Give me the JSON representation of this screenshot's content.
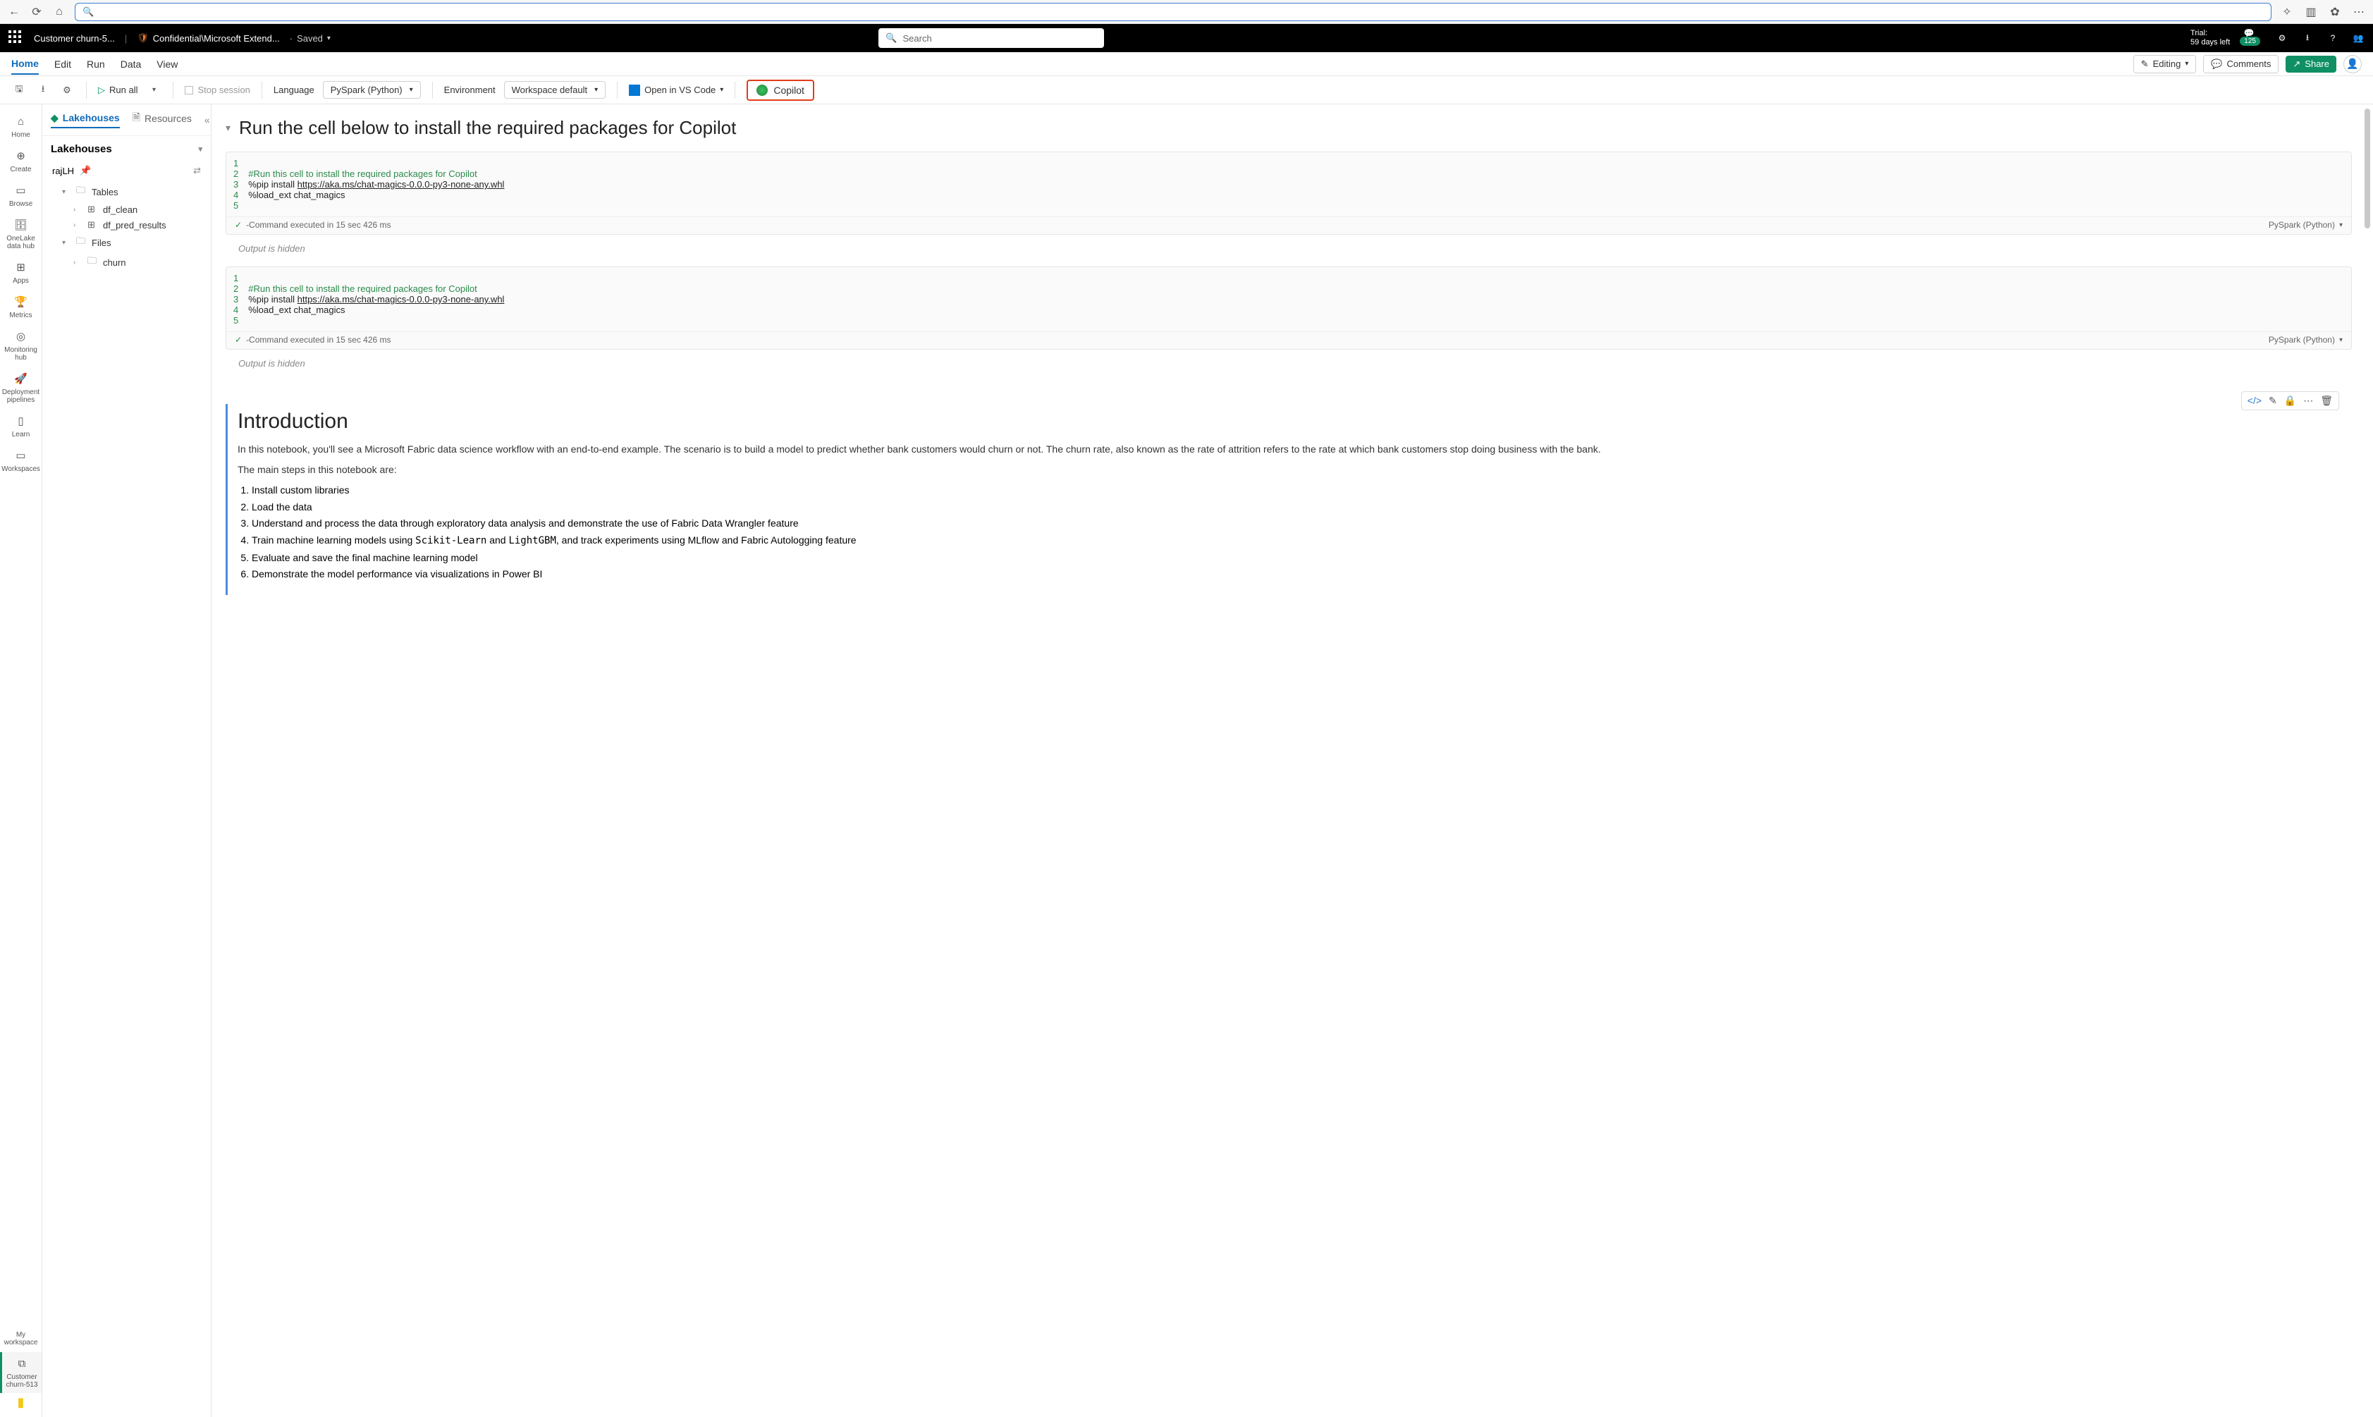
{
  "browser": {
    "search_placeholder": ""
  },
  "header": {
    "doc_title": "Customer churn-5...",
    "confidential": "Confidential\\Microsoft Extend...",
    "saved_label": "Saved",
    "search_placeholder": "Search",
    "trial_label": "Trial:",
    "trial_days": "59 days left",
    "badge_count": "125"
  },
  "tabs": {
    "items": [
      "Home",
      "Edit",
      "Run",
      "Data",
      "View"
    ],
    "editing": "Editing",
    "comments": "Comments",
    "share": "Share"
  },
  "toolbar": {
    "run_all": "Run all",
    "stop_session": "Stop session",
    "language_label": "Language",
    "language_value": "PySpark (Python)",
    "env_label": "Environment",
    "env_value": "Workspace default",
    "vscode": "Open in VS Code",
    "copilot": "Copilot"
  },
  "rail": {
    "items": [
      {
        "label": "Home"
      },
      {
        "label": "Create"
      },
      {
        "label": "Browse"
      },
      {
        "label": "OneLake data hub"
      },
      {
        "label": "Apps"
      },
      {
        "label": "Metrics"
      },
      {
        "label": "Monitoring hub"
      },
      {
        "label": "Deployment pipelines"
      },
      {
        "label": "Learn"
      },
      {
        "label": "Workspaces"
      }
    ],
    "my_workspace": "My workspace",
    "doc_item": "Customer churn-513"
  },
  "explorer": {
    "tab_lakehouses": "Lakehouses",
    "tab_resources": "Resources",
    "title": "Lakehouses",
    "lakehouse_name": "rajLH",
    "tables_label": "Tables",
    "tables": [
      "df_clean",
      "df_pred_results"
    ],
    "files_label": "Files",
    "files": [
      "churn"
    ]
  },
  "notebook": {
    "section1_title": "Run the cell below to install the required packages for Copilot",
    "cell_status_text": "-Command executed in 15 sec 426 ms",
    "cell_lang": "PySpark (Python)",
    "output_hidden": "Output is hidden",
    "code_comment": "#Run this cell to install the required packages for Copilot",
    "code_pip": "%pip install ",
    "code_url": "https://aka.ms/chat-magics-0.0.0-py3-none-any.whl",
    "code_load": "%load_ext chat_magics",
    "intro_title": "Introduction",
    "intro_p1": "In this notebook, you'll see a Microsoft Fabric data science workflow with an end-to-end example. The scenario is to build a model to predict whether bank customers would churn or not. The churn rate, also known as the rate of attrition refers to the rate at which bank customers stop doing business with the bank.",
    "intro_p2": "The main steps in this notebook are:",
    "steps": [
      "Install custom libraries",
      "Load the data",
      "Understand and process the data through exploratory data analysis and demonstrate the use of Fabric Data Wrangler feature",
      "Train machine learning models using Scikit-Learn and LightGBM, and track experiments using MLflow and Fabric Autologging feature",
      "Evaluate and save the final machine learning model",
      "Demonstrate the model performance via visualizations in Power BI"
    ]
  }
}
